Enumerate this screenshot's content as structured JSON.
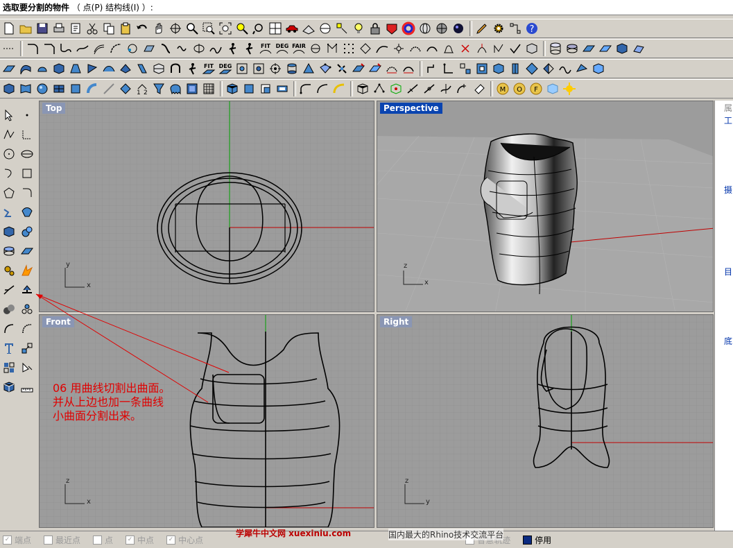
{
  "command_line": {
    "prompt": "选取要分割的物件",
    "options": "（ 点(P)  结构线(I) ）:"
  },
  "viewports": {
    "top": "Top",
    "perspective": "Perspective",
    "front": "Front",
    "right": "Right"
  },
  "axes": {
    "x": "x",
    "y": "y",
    "z": "z"
  },
  "toolbar_labels": {
    "fit": "FIT",
    "deg": "DEG",
    "fair": "FAIR"
  },
  "annotation": {
    "line1": "06 用曲线切割出曲面。",
    "line2": "并从上边也加一条曲线",
    "line3": "小曲面分割出来。"
  },
  "right_panel": [
    "属",
    "工",
    "摄",
    "目",
    "底"
  ],
  "status_bar": {
    "snaps": [
      {
        "label": "端点",
        "checked": true
      },
      {
        "label": "最近点",
        "checked": false
      },
      {
        "label": "点",
        "checked": false
      },
      {
        "label": "中点",
        "checked": true
      },
      {
        "label": "中心点",
        "checked": true
      },
      {
        "label": "智慧轨迹",
        "checked": false
      },
      {
        "label": "停用",
        "checked": true
      }
    ]
  },
  "watermark": {
    "site": "学犀牛中文网 xuexiniu.com",
    "slogan": "国内最大的Rhino技术交流平台"
  },
  "colors": {
    "active_label": "#0a44b0",
    "inactive_label": "#8a96b4",
    "x_axis": "#c00000",
    "y_axis": "#00a000",
    "annotation": "#e00000"
  }
}
